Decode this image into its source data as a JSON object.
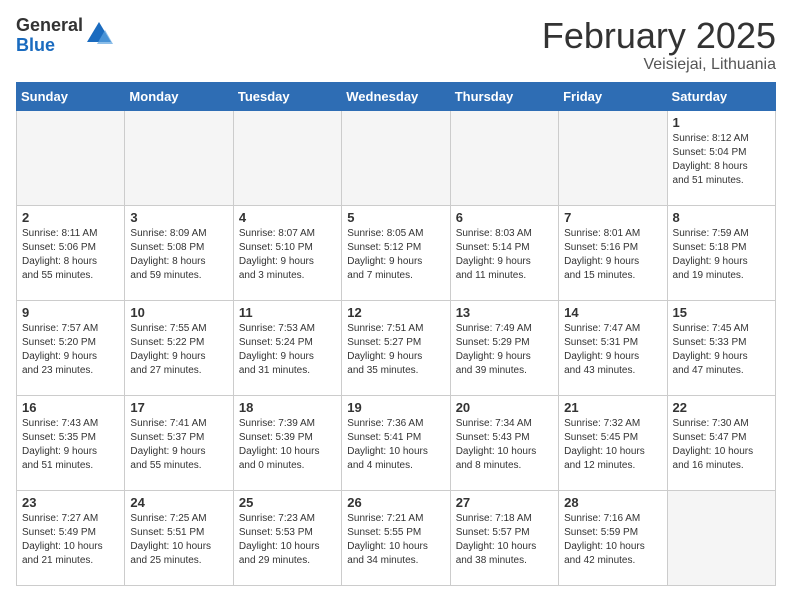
{
  "logo": {
    "general": "General",
    "blue": "Blue"
  },
  "title": "February 2025",
  "location": "Veisiejai, Lithuania",
  "weekdays": [
    "Sunday",
    "Monday",
    "Tuesday",
    "Wednesday",
    "Thursday",
    "Friday",
    "Saturday"
  ],
  "weeks": [
    [
      {
        "day": "",
        "info": ""
      },
      {
        "day": "",
        "info": ""
      },
      {
        "day": "",
        "info": ""
      },
      {
        "day": "",
        "info": ""
      },
      {
        "day": "",
        "info": ""
      },
      {
        "day": "",
        "info": ""
      },
      {
        "day": "1",
        "info": "Sunrise: 8:12 AM\nSunset: 5:04 PM\nDaylight: 8 hours\nand 51 minutes."
      }
    ],
    [
      {
        "day": "2",
        "info": "Sunrise: 8:11 AM\nSunset: 5:06 PM\nDaylight: 8 hours\nand 55 minutes."
      },
      {
        "day": "3",
        "info": "Sunrise: 8:09 AM\nSunset: 5:08 PM\nDaylight: 8 hours\nand 59 minutes."
      },
      {
        "day": "4",
        "info": "Sunrise: 8:07 AM\nSunset: 5:10 PM\nDaylight: 9 hours\nand 3 minutes."
      },
      {
        "day": "5",
        "info": "Sunrise: 8:05 AM\nSunset: 5:12 PM\nDaylight: 9 hours\nand 7 minutes."
      },
      {
        "day": "6",
        "info": "Sunrise: 8:03 AM\nSunset: 5:14 PM\nDaylight: 9 hours\nand 11 minutes."
      },
      {
        "day": "7",
        "info": "Sunrise: 8:01 AM\nSunset: 5:16 PM\nDaylight: 9 hours\nand 15 minutes."
      },
      {
        "day": "8",
        "info": "Sunrise: 7:59 AM\nSunset: 5:18 PM\nDaylight: 9 hours\nand 19 minutes."
      }
    ],
    [
      {
        "day": "9",
        "info": "Sunrise: 7:57 AM\nSunset: 5:20 PM\nDaylight: 9 hours\nand 23 minutes."
      },
      {
        "day": "10",
        "info": "Sunrise: 7:55 AM\nSunset: 5:22 PM\nDaylight: 9 hours\nand 27 minutes."
      },
      {
        "day": "11",
        "info": "Sunrise: 7:53 AM\nSunset: 5:24 PM\nDaylight: 9 hours\nand 31 minutes."
      },
      {
        "day": "12",
        "info": "Sunrise: 7:51 AM\nSunset: 5:27 PM\nDaylight: 9 hours\nand 35 minutes."
      },
      {
        "day": "13",
        "info": "Sunrise: 7:49 AM\nSunset: 5:29 PM\nDaylight: 9 hours\nand 39 minutes."
      },
      {
        "day": "14",
        "info": "Sunrise: 7:47 AM\nSunset: 5:31 PM\nDaylight: 9 hours\nand 43 minutes."
      },
      {
        "day": "15",
        "info": "Sunrise: 7:45 AM\nSunset: 5:33 PM\nDaylight: 9 hours\nand 47 minutes."
      }
    ],
    [
      {
        "day": "16",
        "info": "Sunrise: 7:43 AM\nSunset: 5:35 PM\nDaylight: 9 hours\nand 51 minutes."
      },
      {
        "day": "17",
        "info": "Sunrise: 7:41 AM\nSunset: 5:37 PM\nDaylight: 9 hours\nand 55 minutes."
      },
      {
        "day": "18",
        "info": "Sunrise: 7:39 AM\nSunset: 5:39 PM\nDaylight: 10 hours\nand 0 minutes."
      },
      {
        "day": "19",
        "info": "Sunrise: 7:36 AM\nSunset: 5:41 PM\nDaylight: 10 hours\nand 4 minutes."
      },
      {
        "day": "20",
        "info": "Sunrise: 7:34 AM\nSunset: 5:43 PM\nDaylight: 10 hours\nand 8 minutes."
      },
      {
        "day": "21",
        "info": "Sunrise: 7:32 AM\nSunset: 5:45 PM\nDaylight: 10 hours\nand 12 minutes."
      },
      {
        "day": "22",
        "info": "Sunrise: 7:30 AM\nSunset: 5:47 PM\nDaylight: 10 hours\nand 16 minutes."
      }
    ],
    [
      {
        "day": "23",
        "info": "Sunrise: 7:27 AM\nSunset: 5:49 PM\nDaylight: 10 hours\nand 21 minutes."
      },
      {
        "day": "24",
        "info": "Sunrise: 7:25 AM\nSunset: 5:51 PM\nDaylight: 10 hours\nand 25 minutes."
      },
      {
        "day": "25",
        "info": "Sunrise: 7:23 AM\nSunset: 5:53 PM\nDaylight: 10 hours\nand 29 minutes."
      },
      {
        "day": "26",
        "info": "Sunrise: 7:21 AM\nSunset: 5:55 PM\nDaylight: 10 hours\nand 34 minutes."
      },
      {
        "day": "27",
        "info": "Sunrise: 7:18 AM\nSunset: 5:57 PM\nDaylight: 10 hours\nand 38 minutes."
      },
      {
        "day": "28",
        "info": "Sunrise: 7:16 AM\nSunset: 5:59 PM\nDaylight: 10 hours\nand 42 minutes."
      },
      {
        "day": "",
        "info": ""
      }
    ]
  ]
}
